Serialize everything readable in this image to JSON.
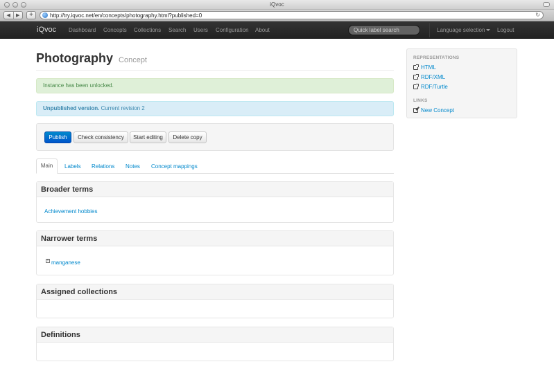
{
  "window": {
    "title": "iQvoc",
    "url": "http://try.iqvoc.net/en/concepts/photography.html?published=0"
  },
  "navbar": {
    "brand": "iQvoc",
    "links": [
      "Dashboard",
      "Concepts",
      "Collections",
      "Search",
      "Users",
      "Configuration",
      "About"
    ],
    "search_placeholder": "Quick label search",
    "language_selection": "Language selection",
    "logout": "Logout"
  },
  "page": {
    "title": "Photography",
    "subtitle": "Concept"
  },
  "alerts": {
    "success": "Instance has been unlocked.",
    "info_bold": "Unpublished version.",
    "info_text": "Current revision 2"
  },
  "actions": {
    "publish": "Publish",
    "check_consistency": "Check consistency",
    "start_editing": "Start editing",
    "delete_copy": "Delete copy"
  },
  "tabs": [
    "Main",
    "Labels",
    "Relations",
    "Notes",
    "Concept mappings"
  ],
  "panels": {
    "broader": {
      "title": "Broader terms",
      "items": [
        "Achievement hobbies"
      ]
    },
    "narrower": {
      "title": "Narrower terms",
      "items": [
        "manganese"
      ]
    },
    "collections": {
      "title": "Assigned collections"
    },
    "definitions": {
      "title": "Definitions"
    }
  },
  "sidebar": {
    "representations_header": "REPRESENTATIONS",
    "representations": [
      "HTML",
      "RDF/XML",
      "RDF/Turtle"
    ],
    "links_header": "LINKS",
    "links": [
      "New Concept"
    ]
  },
  "colors": {
    "link": "#0088cc",
    "primary_button": "#0074cc",
    "navbar": "#2c2c2c",
    "success_bg": "#dff0d8",
    "info_bg": "#d9edf7"
  }
}
